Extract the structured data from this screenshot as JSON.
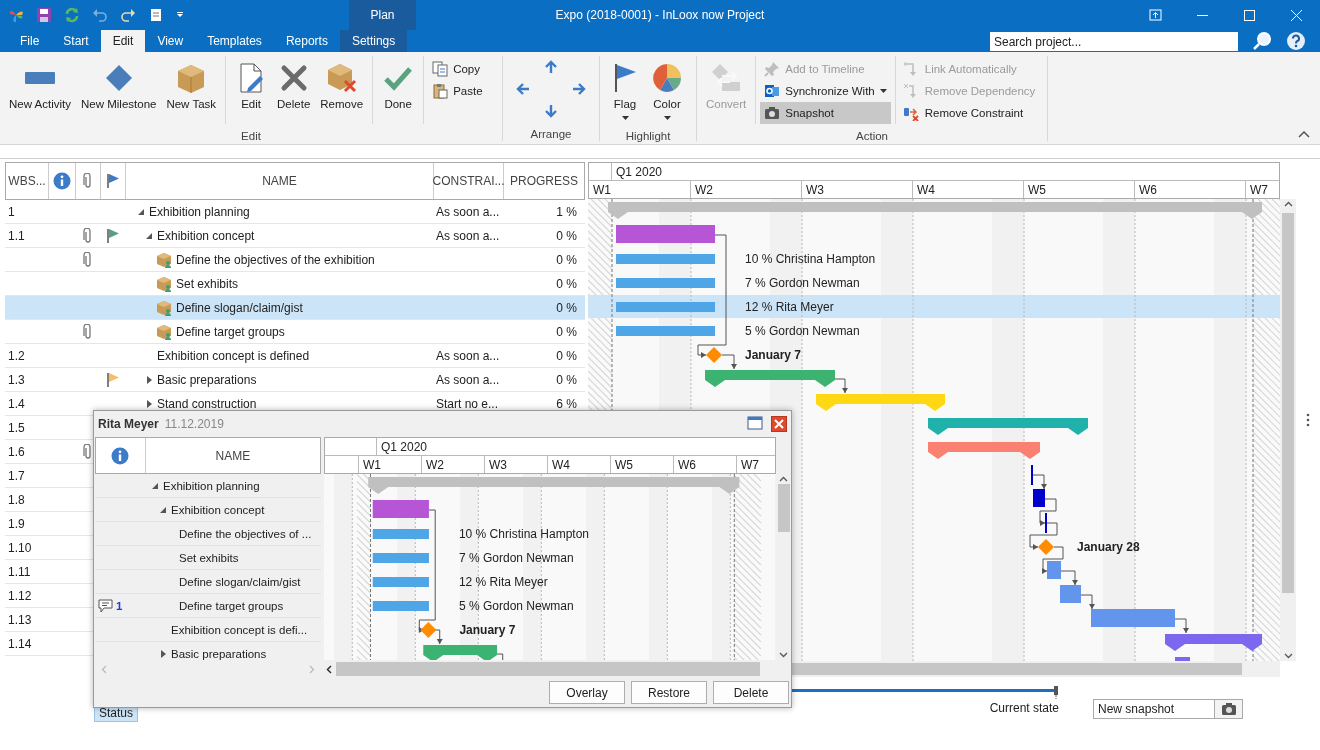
{
  "quick_access": [
    {
      "disabled": false
    },
    {
      "disabled": false
    },
    {
      "disabled": false
    },
    {
      "disabled": true
    },
    {
      "disabled": false
    },
    {
      "disabled": false
    },
    {
      "disabled": false
    }
  ],
  "window": {
    "title": "Expo (2018-0001) - InLoox now Project",
    "context_group": "Plan"
  },
  "tabs": [
    {
      "label": "File",
      "selected": false,
      "contextual": false
    },
    {
      "label": "Start",
      "selected": false,
      "contextual": false
    },
    {
      "label": "Edit",
      "selected": true,
      "contextual": false
    },
    {
      "label": "View",
      "selected": false,
      "contextual": false
    },
    {
      "label": "Templates",
      "selected": false,
      "contextual": false
    },
    {
      "label": "Reports",
      "selected": false,
      "contextual": false
    },
    {
      "label": "Settings",
      "selected": false,
      "contextual": true
    }
  ],
  "search": {
    "placeholder": "Search project..."
  },
  "ribbon": {
    "groups": [
      {
        "label": "Edit",
        "sections": [
          {
            "kind": "large",
            "items": [
              {
                "label": "New Activity",
                "disabled": false,
                "dropdown": false,
                "pressed": false
              },
              {
                "label": "New Milestone",
                "disabled": false,
                "dropdown": false,
                "pressed": false
              },
              {
                "label": "New Task",
                "disabled": false,
                "dropdown": false,
                "pressed": false
              }
            ]
          },
          {
            "kind": "large",
            "items": [
              {
                "label": "Edit",
                "disabled": false,
                "dropdown": false,
                "pressed": false
              },
              {
                "label": "Delete",
                "disabled": false,
                "dropdown": false,
                "pressed": false
              },
              {
                "label": "Remove",
                "disabled": false,
                "dropdown": false,
                "pressed": false
              }
            ]
          },
          {
            "kind": "large",
            "items": [
              {
                "label": "Done",
                "disabled": false,
                "dropdown": false,
                "pressed": false
              }
            ]
          },
          {
            "kind": "small",
            "items": [
              {
                "label": "Copy",
                "disabled": false,
                "dropdown": false,
                "pressed": false
              },
              {
                "label": "Paste",
                "disabled": false,
                "dropdown": false,
                "pressed": false
              }
            ]
          }
        ]
      },
      {
        "label": "Arrange",
        "sections": [
          {
            "kind": "arrows"
          }
        ]
      },
      {
        "label": "Highlight",
        "sections": [
          {
            "kind": "large",
            "items": [
              {
                "label": "Flag",
                "disabled": false,
                "dropdown": true,
                "pressed": false
              },
              {
                "label": "Color",
                "disabled": false,
                "dropdown": true,
                "pressed": false
              }
            ]
          }
        ]
      },
      {
        "label": "Action",
        "sections": [
          {
            "kind": "large",
            "items": [
              {
                "label": "Convert",
                "disabled": true,
                "dropdown": false,
                "pressed": false
              }
            ]
          },
          {
            "kind": "small",
            "items": [
              {
                "label": "Add to Timeline",
                "disabled": true,
                "dropdown": false,
                "pressed": false
              },
              {
                "label": "Synchronize With",
                "disabled": false,
                "dropdown": true,
                "pressed": false
              },
              {
                "label": "Snapshot",
                "disabled": false,
                "dropdown": false,
                "pressed": true
              }
            ]
          },
          {
            "kind": "small",
            "items": [
              {
                "label": "Link Automatically",
                "disabled": true,
                "dropdown": false,
                "pressed": false
              },
              {
                "label": "Remove Dependency",
                "disabled": true,
                "dropdown": false,
                "pressed": false
              },
              {
                "label": "Remove Constraint",
                "disabled": false,
                "dropdown": false,
                "pressed": false
              }
            ]
          }
        ]
      }
    ]
  },
  "table": {
    "columns": [
      {
        "kind": "text",
        "label": "WBS..."
      },
      {
        "kind": "info"
      },
      {
        "kind": "attachment"
      },
      {
        "kind": "flag"
      },
      {
        "kind": "text",
        "label": "NAME"
      },
      {
        "kind": "text",
        "label": "CONSTRAI..."
      },
      {
        "kind": "text",
        "label": "PROGRESS"
      }
    ],
    "rows": [
      {
        "wbs": "1",
        "kind": "summary",
        "expanded": true,
        "attachment": false,
        "name": "Exhibition planning",
        "constraint": "As soon a...",
        "progress": "1 %",
        "selected": false,
        "children": [
          {
            "wbs": "1.1",
            "kind": "summary",
            "expanded": true,
            "attachment": true,
            "flag": {
              "color": "#5a9e86"
            },
            "name": "Exhibition concept",
            "constraint": "As soon a...",
            "progress": "0 %",
            "selected": false,
            "children": [
              {
                "kind": "task",
                "attachment": true,
                "name": "Define the objectives of the exhibition",
                "progress": "0 %",
                "selected": false
              },
              {
                "kind": "task",
                "attachment": false,
                "name": "Set exhibits",
                "progress": "0 %",
                "selected": false
              },
              {
                "kind": "task",
                "attachment": false,
                "name": "Define slogan/claim/gist",
                "progress": "0 %",
                "selected": true
              },
              {
                "kind": "task",
                "attachment": true,
                "name": "Define target groups",
                "progress": "0 %",
                "selected": false
              }
            ]
          },
          {
            "wbs": "1.2",
            "kind": "milestone",
            "attachment": false,
            "name": "Exhibition concept is defined",
            "constraint": "As soon a...",
            "progress": "0 %",
            "selected": false
          },
          {
            "wbs": "1.3",
            "kind": "summary",
            "expanded": false,
            "attachment": false,
            "flag": {
              "color": "#f2c06a"
            },
            "name": "Basic preparations",
            "constraint": "As soon a...",
            "progress": "0 %",
            "selected": false
          },
          {
            "wbs": "1.4",
            "kind": "summary",
            "expanded": false,
            "attachment": false,
            "name": "Stand construction",
            "constraint": "Start no e...",
            "progress": "6 %",
            "selected": false
          },
          {
            "wbs": "1.5",
            "attachment": false,
            "selected": false
          },
          {
            "wbs": "1.6",
            "attachment": true,
            "selected": false
          },
          {
            "wbs": "1.7",
            "attachment": false,
            "selected": false
          },
          {
            "wbs": "1.8",
            "attachment": false,
            "selected": false
          },
          {
            "wbs": "1.9",
            "attachment": false,
            "selected": false
          },
          {
            "wbs": "1.10",
            "attachment": false,
            "selected": false
          },
          {
            "wbs": "1.11",
            "attachment": false,
            "selected": false
          },
          {
            "wbs": "1.12",
            "attachment": false,
            "selected": false
          },
          {
            "wbs": "1.13",
            "attachment": false,
            "selected": false
          },
          {
            "wbs": "1.14",
            "attachment": false,
            "selected": false
          }
        ]
      }
    ]
  },
  "gantt": {
    "quarter": "Q1 2020",
    "weeks": [
      "W1",
      "W2",
      "W3",
      "W4",
      "W5",
      "W6",
      "W7"
    ],
    "bars": [
      {
        "kind": "summary",
        "color": "#c0c0c0"
      },
      {
        "kind": "block",
        "color": "#b655d6"
      },
      {
        "kind": "task",
        "color": "#4ea6e6",
        "label": "10 % Christina Hampton"
      },
      {
        "kind": "task",
        "color": "#4ea6e6",
        "label": "7 % Gordon Newman"
      },
      {
        "kind": "task",
        "color": "#4ea6e6",
        "label": "12 % Rita Meyer"
      },
      {
        "kind": "task",
        "color": "#4ea6e6",
        "label": "5 % Gordon Newman"
      },
      {
        "kind": "milestone",
        "color": "#ff8c00",
        "label": "January 7"
      },
      {
        "kind": "summary",
        "color": "#3cb371"
      },
      {
        "kind": "summary",
        "color": "#ffd814"
      },
      {
        "kind": "summary",
        "color": "#20b2aa"
      },
      {
        "kind": "summary",
        "color": "#fa8072"
      },
      {
        "kind": "marker",
        "color": "#0000cd"
      },
      {
        "kind": "block",
        "color": "#0000cd"
      },
      {
        "kind": "marker",
        "color": "#0000cd"
      },
      {
        "kind": "milestone",
        "color": "#ff8c00",
        "label": "January 28"
      },
      {
        "kind": "block",
        "color": "#6495ed"
      },
      {
        "kind": "block",
        "color": "#6495ed"
      },
      {
        "kind": "block",
        "color": "#6495ed"
      },
      {
        "kind": "summary",
        "color": "#7b68ee"
      },
      {
        "kind": "block",
        "color": "#7b68ee"
      }
    ]
  },
  "popup": {
    "title": "Rita Meyer",
    "date": "11.12.2019",
    "columns": [
      {
        "kind": "info"
      },
      {
        "kind": "text",
        "label": "NAME"
      }
    ],
    "rows": [
      {
        "kind": "summary",
        "expanded": true,
        "name": "Exhibition planning",
        "children": [
          {
            "kind": "summary",
            "expanded": true,
            "name": "Exhibition concept",
            "children": [
              {
                "kind": "task",
                "name": "Define the objectives of ..."
              },
              {
                "kind": "task",
                "name": "Set exhibits"
              },
              {
                "kind": "task",
                "name": "Define slogan/claim/gist"
              },
              {
                "kind": "task",
                "name": "Define target groups",
                "comments": "1"
              }
            ]
          },
          {
            "kind": "milestone",
            "name": "Exhibition concept is defi..."
          },
          {
            "kind": "summary",
            "expanded": false,
            "name": "Basic preparations"
          }
        ]
      }
    ],
    "gantt": {
      "quarter": "Q1 2020",
      "weeks": [
        "W1",
        "W2",
        "W3",
        "W4",
        "W5",
        "W6",
        "W7"
      ],
      "bars": [
        {
          "kind": "summary",
          "color": "#c0c0c0"
        },
        {
          "kind": "block",
          "color": "#b655d6"
        },
        {
          "kind": "task",
          "color": "#4ea6e6",
          "label": "10 % Christina Hampton"
        },
        {
          "kind": "task",
          "color": "#4ea6e6",
          "label": "7 % Gordon Newman"
        },
        {
          "kind": "task",
          "color": "#4ea6e6",
          "label": "12 % Rita Meyer"
        },
        {
          "kind": "task",
          "color": "#4ea6e6",
          "label": "5 % Gordon Newman"
        },
        {
          "kind": "milestone",
          "color": "#ff8c00",
          "label": "January 7"
        },
        {
          "kind": "summary",
          "color": "#3cb371"
        }
      ]
    },
    "buttons": [
      "Overlay",
      "Restore",
      "Delete"
    ]
  },
  "status_tabs": [
    {
      "label": "Status",
      "selected": true
    }
  ],
  "snapshots": {
    "marker_label": "Current state",
    "new_snapshot": {
      "value": "New snapshot"
    }
  }
}
